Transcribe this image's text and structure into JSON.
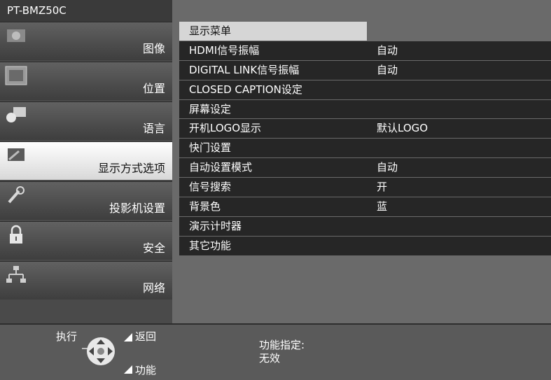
{
  "model": "PT-BMZ50C",
  "sidebar": {
    "items": [
      {
        "label": "图像",
        "icon": "picture-icon"
      },
      {
        "label": "位置",
        "icon": "position-icon"
      },
      {
        "label": "语言",
        "icon": "language-icon"
      },
      {
        "label": "显示方式选项",
        "icon": "display-option-icon"
      },
      {
        "label": "投影机设置",
        "icon": "projector-setting-icon"
      },
      {
        "label": "安全",
        "icon": "lock-icon"
      },
      {
        "label": "网络",
        "icon": "network-icon"
      }
    ]
  },
  "menu": {
    "title": "显示菜单",
    "rows": [
      {
        "label": "HDMI信号振幅",
        "value": "自动"
      },
      {
        "label": "DIGITAL LINK信号振幅",
        "value": "自动"
      },
      {
        "label": "CLOSED CAPTION设定",
        "value": ""
      },
      {
        "label": "屏幕设定",
        "value": ""
      },
      {
        "label": "开机LOGO显示",
        "value": "默认LOGO"
      },
      {
        "label": "快门设置",
        "value": ""
      },
      {
        "label": "自动设置模式",
        "value": "自动"
      },
      {
        "label": "信号搜索",
        "value": "开"
      },
      {
        "label": "背景色",
        "value": "蓝"
      },
      {
        "label": "演示计时器",
        "value": ""
      },
      {
        "label": "其它功能",
        "value": ""
      }
    ]
  },
  "footer": {
    "execute": "执行",
    "back": "返回",
    "function": "功能",
    "assign_label": "功能指定:",
    "assign_value": "无效"
  }
}
